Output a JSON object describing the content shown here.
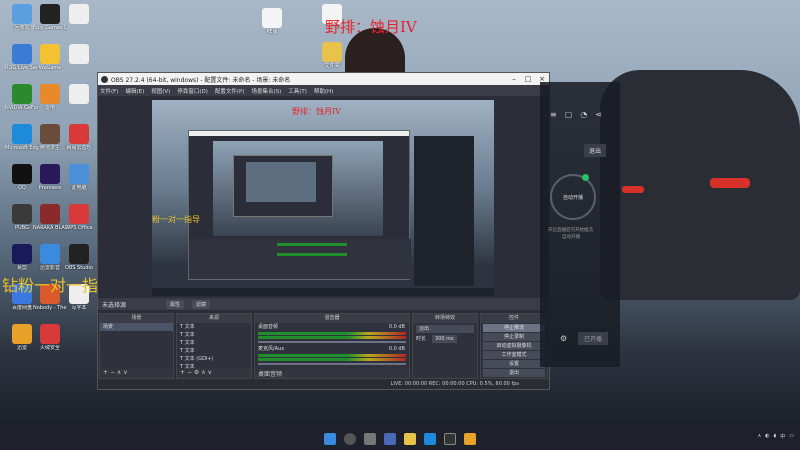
{
  "overlay": {
    "top_text": "野排：蚀月IV",
    "left_text": "钻粉一对一指导",
    "preview_text_1": "野排：蚀月IV",
    "preview_text_2": "粉一对一指导"
  },
  "desktop_icons": [
    {
      "label": "回收站",
      "color": "#5aa0e0"
    },
    {
      "label": "Epic Games Launcher",
      "color": "#222"
    },
    {
      "label": "",
      "color": "#eee"
    },
    {
      "label": "ROG Live Service",
      "color": "#3a7bd5"
    },
    {
      "label": "WeGame",
      "color": "#f2c230"
    },
    {
      "label": "",
      "color": "#eee"
    },
    {
      "label": "NVIDIA GeForce Experience",
      "color": "#2b8a2b"
    },
    {
      "label": "雷电",
      "color": "#e88a2a"
    },
    {
      "label": "",
      "color": "#eee"
    },
    {
      "label": "Microsoft Edge",
      "color": "#1d8adb"
    },
    {
      "label": "绝地求生",
      "color": "#6b4b3b"
    },
    {
      "label": "网易云音乐",
      "color": "#d83a3a"
    },
    {
      "label": "QQ",
      "color": "#111"
    },
    {
      "label": "Premiere",
      "color": "#2a1a5a"
    },
    {
      "label": "此电脑",
      "color": "#4a90d8"
    },
    {
      "label": "PUBG",
      "color": "#3a3a3a"
    },
    {
      "label": "NARAKA BLADEPOINT",
      "color": "#8a2a2a"
    },
    {
      "label": "WPS Office",
      "color": "#d83a3a"
    },
    {
      "label": "易剪",
      "color": "#1a1a5a"
    },
    {
      "label": "迅雷影音",
      "color": "#3a8ae0"
    },
    {
      "label": "OBS Studio",
      "color": "#222"
    },
    {
      "label": "百度网盘",
      "color": "#3a7ae0"
    },
    {
      "label": "Nobody - The Turnaround",
      "color": "#d85a2a"
    },
    {
      "label": "写字本",
      "color": "#eee"
    },
    {
      "label": "迅雷",
      "color": "#e8a22a"
    },
    {
      "label": "火绒安全",
      "color": "#d83a3a"
    }
  ],
  "file_icons": [
    {
      "label": "PE版",
      "color": "#f4f4f4"
    },
    {
      "label": "",
      "color": "#f4f4f4"
    },
    {
      "label": "文件夹",
      "color": "#e8c24a"
    }
  ],
  "obs": {
    "title": "OBS 27.2.4 (64-bit, windows) - 配置文件: 未命名 - 场景: 未命名",
    "menu": [
      "文件(F)",
      "编辑(E)",
      "视图(V)",
      "停靠窗口(D)",
      "配置文件(P)",
      "场景集合(S)",
      "工具(T)",
      "帮助(H)"
    ],
    "scene_bar_label": "未选择源",
    "scene_bar_btn1": "属性",
    "scene_bar_btn2": "滤镜",
    "docks": {
      "scenes": {
        "header": "场景",
        "items": [
          "场景"
        ]
      },
      "sources": {
        "header": "来源",
        "items": [
          "文本",
          "文本",
          "文本",
          "文本",
          "文本 (GDI+)",
          "文本"
        ]
      },
      "mixer": {
        "header": "混音器",
        "track1": "桌面音频",
        "track1_db": "0.0 dB",
        "track2": "麦克风/Aux",
        "track2_db": "0.0 dB",
        "footer": "桌面音频"
      },
      "transitions": {
        "header": "转场特效",
        "type": "淡出",
        "duration_label": "时长",
        "duration": "300 ms"
      },
      "controls": {
        "header": "控件",
        "buttons": [
          "停止推流",
          "停止录制",
          "启动虚拟摄像机",
          "工作室模式",
          "设置",
          "退出"
        ]
      }
    },
    "status": "LIVE: 00:00:00  REC: 00:00:00  CPU: 0.5%, 60.00 fps"
  },
  "right_app": {
    "exit_label": "退出",
    "center_label": "自动开播",
    "hint": "开启直播后可开始推流",
    "sub_hint": "自动开播",
    "bottom_btn": "已开播"
  },
  "tray": {
    "time": "",
    "lang": "中"
  }
}
